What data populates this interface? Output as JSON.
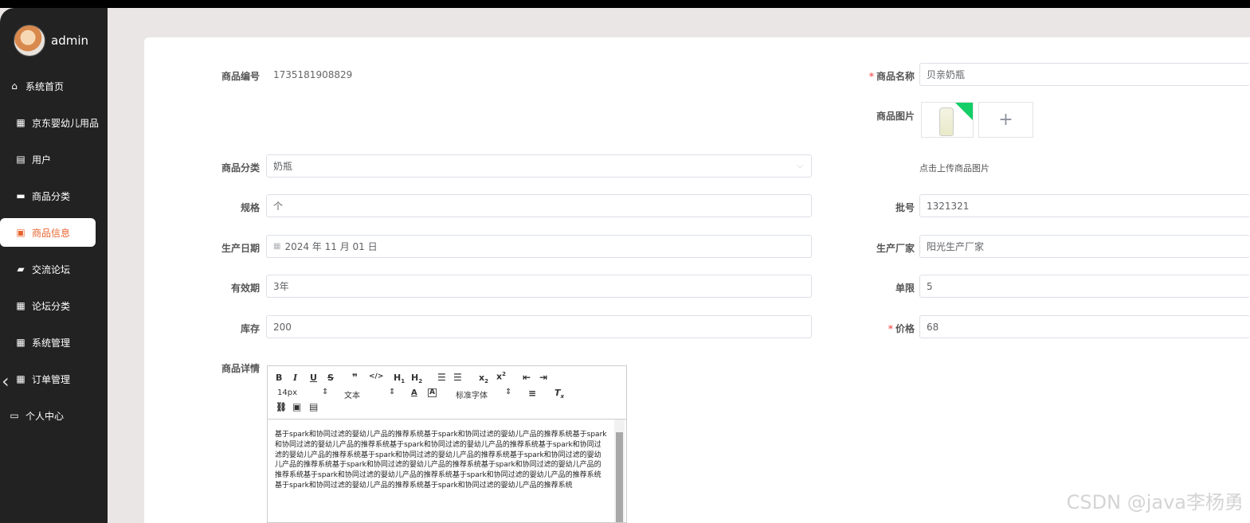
{
  "user": {
    "name": "admin"
  },
  "menu": [
    {
      "label": "系统首页",
      "icon": "home-icon",
      "glyph": "⌂"
    },
    {
      "label": "京东婴幼儿用品",
      "icon": "grid-icon",
      "glyph": "▦"
    },
    {
      "label": "用户",
      "icon": "chart-icon",
      "glyph": "▤"
    },
    {
      "label": "商品分类",
      "icon": "ticket-icon",
      "glyph": "▬"
    },
    {
      "label": "商品信息",
      "icon": "clipboard-icon",
      "glyph": "▣",
      "active": true
    },
    {
      "label": "交流论坛",
      "icon": "thumb-icon",
      "glyph": "▰"
    },
    {
      "label": "论坛分类",
      "icon": "grid-icon",
      "glyph": "▦"
    },
    {
      "label": "系统管理",
      "icon": "grid-icon",
      "glyph": "▦"
    },
    {
      "label": "订单管理",
      "icon": "grid-icon",
      "glyph": "▦"
    },
    {
      "label": "个人中心",
      "icon": "profile-icon",
      "glyph": "▭"
    }
  ],
  "form": {
    "code": {
      "label": "商品编号",
      "value": "1735181908829"
    },
    "name": {
      "label": "商品名称",
      "value": "贝亲奶瓶"
    },
    "image": {
      "label": "商品图片",
      "hint": "点击上传商品图片"
    },
    "category": {
      "label": "商品分类",
      "value": "奶瓶"
    },
    "spec": {
      "label": "规格",
      "value": "个"
    },
    "batch": {
      "label": "批号",
      "value": "1321321"
    },
    "date": {
      "label": "生产日期",
      "value": "2024 年 11 月 01 日"
    },
    "maker": {
      "label": "生产厂家",
      "value": "阳光生产厂家"
    },
    "validity": {
      "label": "有效期",
      "value": "3年"
    },
    "limit": {
      "label": "单限",
      "value": "5"
    },
    "stock": {
      "label": "库存",
      "value": "200"
    },
    "price": {
      "label": "价格",
      "value": "68"
    },
    "detail": {
      "label": "商品详情"
    }
  },
  "editor": {
    "font_size": "14px",
    "text_type": "文本",
    "font_family": "标准字体",
    "content": "基于spark和协同过滤的婴幼儿产品的推荐系统基于spark和协同过滤的婴幼儿产品的推荐系统基于spark和协同过滤的婴幼儿产品的推荐系统基于spark和协同过滤的婴幼儿产品的推荐系统基于spark和协同过滤的婴幼儿产品的推荐系统基于spark和协同过滤的婴幼儿产品的推荐系统基于spark和协同过滤的婴幼儿产品的推荐系统基于spark和协同过滤的婴幼儿产品的推荐系统基于spark和协同过滤的婴幼儿产品的推荐系统基于spark和协同过滤的婴幼儿产品的推荐系统基于spark和协同过滤的婴幼儿产品的推荐系统基于spark和协同过滤的婴幼儿产品的推荐系统基于spark和协同过滤的婴幼儿产品的推荐系统"
  },
  "watermark": "CSDN @java李杨勇",
  "colors": {
    "accent": "#e8632e",
    "sidebar": "#222222",
    "required": "#f56c6c"
  }
}
